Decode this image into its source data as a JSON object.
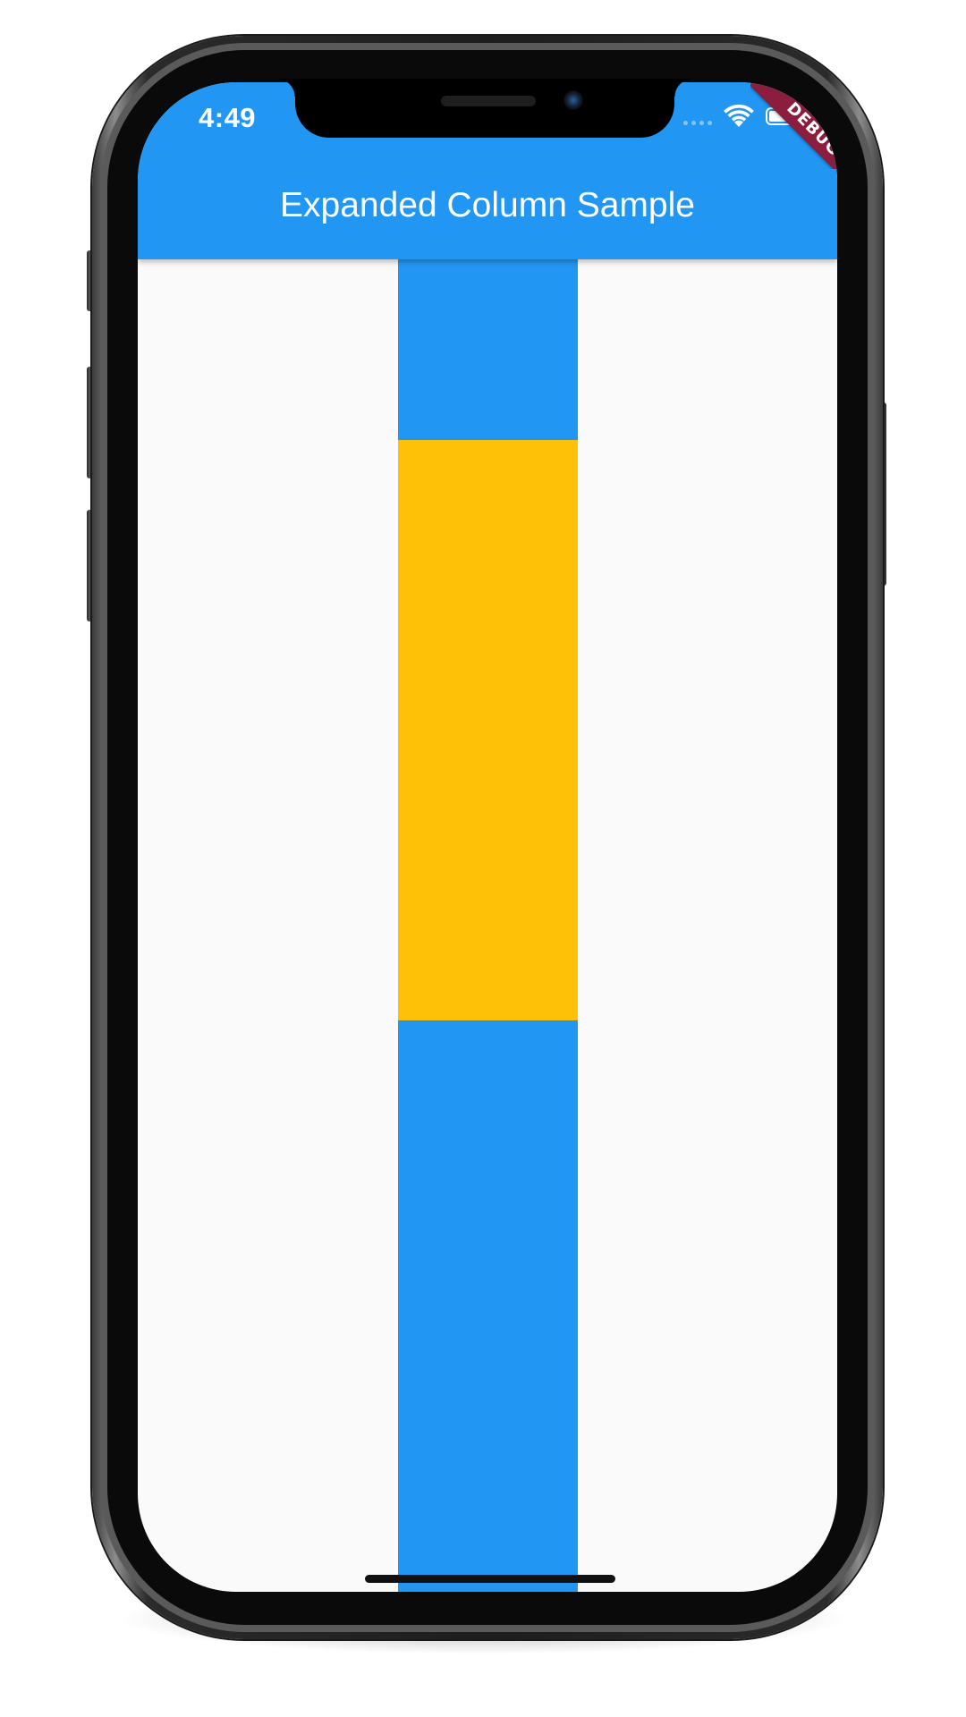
{
  "status_bar": {
    "time": "4:49",
    "icons": [
      "cellular-signal-icon",
      "wifi-icon",
      "battery-icon"
    ]
  },
  "app_bar": {
    "title": "Expanded Column Sample",
    "background_color": "#2196f3"
  },
  "debug_banner": {
    "label": "DEBUG",
    "color": "#8b1e3f"
  },
  "column": {
    "boxes": [
      {
        "name": "top",
        "color": "#2196f3"
      },
      {
        "name": "expanded",
        "color": "#ffc107"
      },
      {
        "name": "bottom",
        "color": "#2196f3"
      }
    ]
  },
  "colors": {
    "primary": "#2196f3",
    "accent": "#ffc107",
    "background": "#fafafa"
  }
}
